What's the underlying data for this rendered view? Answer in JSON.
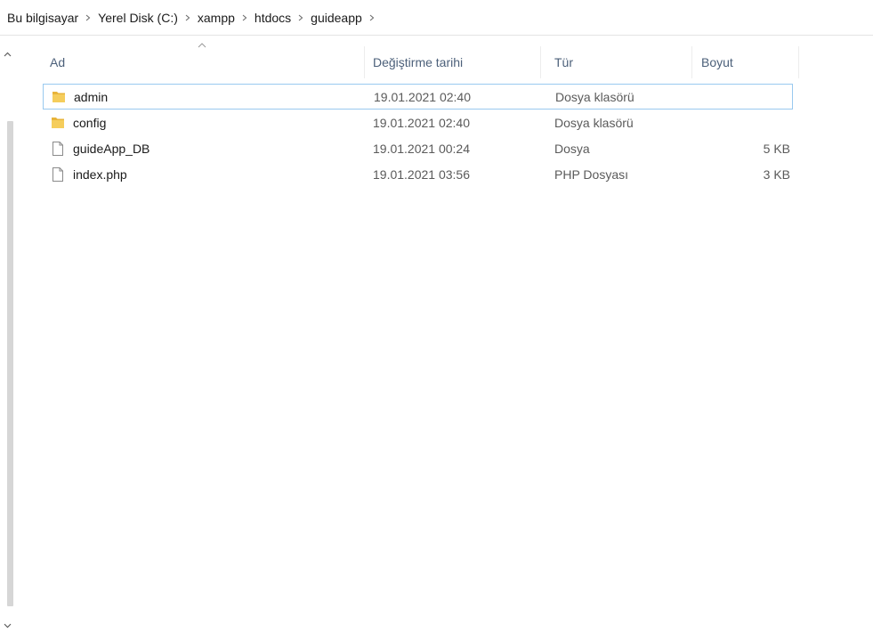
{
  "breadcrumb": {
    "items": [
      "Bu bilgisayar",
      "Yerel Disk (C:)",
      "xampp",
      "htdocs",
      "guideapp"
    ]
  },
  "columns": {
    "name": "Ad",
    "date": "Değiştirme tarihi",
    "type": "Tür",
    "size": "Boyut"
  },
  "files": [
    {
      "name": "admin",
      "date": "19.01.2021 02:40",
      "type": "Dosya klasörü",
      "size": "",
      "icon": "folder-icon",
      "selected": true
    },
    {
      "name": "config",
      "date": "19.01.2021 02:40",
      "type": "Dosya klasörü",
      "size": "",
      "icon": "folder-icon",
      "selected": false
    },
    {
      "name": "guideApp_DB",
      "date": "19.01.2021 00:24",
      "type": "Dosya",
      "size": "5 KB",
      "icon": "file-icon",
      "selected": false
    },
    {
      "name": "index.php",
      "date": "19.01.2021 03:56",
      "type": "PHP Dosyası",
      "size": "3 KB",
      "icon": "file-icon",
      "selected": false
    }
  ],
  "colors": {
    "folder": "#e8b43a",
    "selection_border": "#99c9ef",
    "header_text": "#4c607a"
  }
}
